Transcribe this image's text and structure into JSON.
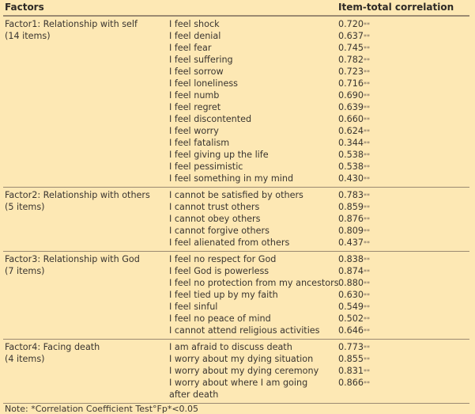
{
  "header": {
    "factors": "Factors",
    "items": "",
    "correlation": "Item-total correlation"
  },
  "significance_marker": "**",
  "groups": [
    {
      "factor": "Factor1: Relationship with self",
      "count": "(14 items)",
      "items": [
        {
          "text": "I feel shock",
          "value": "0.720"
        },
        {
          "text": "I feel denial",
          "value": "0.637"
        },
        {
          "text": "I feel fear",
          "value": "0.745"
        },
        {
          "text": "I feel suffering",
          "value": "0.782"
        },
        {
          "text": "I feel sorrow",
          "value": "0.723"
        },
        {
          "text": "I feel loneliness",
          "value": "0.716"
        },
        {
          "text": "I feel numb",
          "value": "0.690"
        },
        {
          "text": "I feel regret",
          "value": "0.639"
        },
        {
          "text": "I feel discontented",
          "value": "0.660"
        },
        {
          "text": "I feel worry",
          "value": "0.624"
        },
        {
          "text": "I feel fatalism",
          "value": "0.344"
        },
        {
          "text": "I feel giving up the life",
          "value": "0.538"
        },
        {
          "text": "I feel pessimistic",
          "value": "0.538"
        },
        {
          "text": "I feel something in my mind",
          "value": "0.430"
        }
      ]
    },
    {
      "factor": "Factor2: Relationship with others",
      "count": "(5 items)",
      "items": [
        {
          "text": "I cannot be satisfied by others",
          "value": "0.783"
        },
        {
          "text": "I cannot trust others",
          "value": "0.859"
        },
        {
          "text": "I cannot obey others",
          "value": "0.876"
        },
        {
          "text": "I cannot forgive others",
          "value": "0.809"
        },
        {
          "text": "I feel alienated from others",
          "value": "0.437"
        }
      ]
    },
    {
      "factor": "Factor3: Relationship with God",
      "count": "(7 items)",
      "items": [
        {
          "text": "I feel no respect for God",
          "value": "0.838"
        },
        {
          "text": "I feel God is powerless",
          "value": "0.874"
        },
        {
          "text": "I feel no protection from my ancestors",
          "value": "0.880"
        },
        {
          "text": "I feel tied up by my faith",
          "value": "0.630"
        },
        {
          "text": "I feel sinful",
          "value": "0.549"
        },
        {
          "text": "I feel no peace of mind",
          "value": "0.502"
        },
        {
          "text": "I cannot attend religious activities",
          "value": "0.646"
        }
      ]
    },
    {
      "factor": "Factor4: Facing death",
      "count": "(4 items)",
      "items": [
        {
          "text": "I am afraid to discuss death",
          "value": "0.773"
        },
        {
          "text": "I worry about my dying situation",
          "value": "0.855"
        },
        {
          "text": "I worry about my dying ceremony",
          "value": "0.831"
        },
        {
          "text": "I worry about where I am going after death",
          "value": "0.866"
        }
      ]
    }
  ],
  "note": "Note: *Correlation Coefficient Test°Fp*<0.05"
}
